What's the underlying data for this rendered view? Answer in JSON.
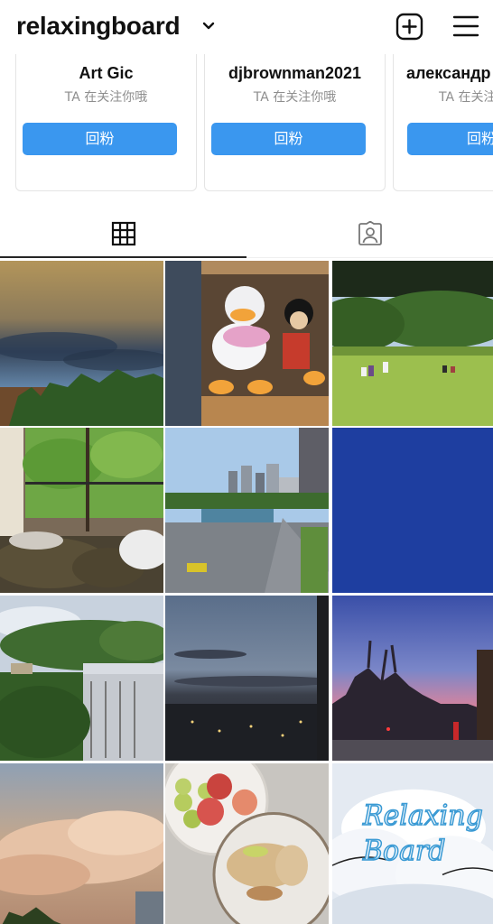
{
  "header": {
    "username": "relaxingboard",
    "icons": {
      "chevron": "chevron-down-icon",
      "new_post": "plus-square-icon",
      "menu": "menu-icon"
    }
  },
  "suggested": [
    {
      "name": "Art Gic",
      "subtitle": "TA 在关注你哦",
      "button": "回粉"
    },
    {
      "name": "djbrownman2021",
      "subtitle": "TA 在关注你哦",
      "button": "回粉"
    },
    {
      "name": "александр",
      "subtitle": "TA 在关注你哦",
      "button": "回粉"
    }
  ],
  "tabs": [
    {
      "name": "posts-grid",
      "icon": "grid-icon",
      "active": true
    },
    {
      "name": "tagged",
      "icon": "tagged-user-icon",
      "active": false
    }
  ],
  "posts": [
    {
      "subject": "dramatic-cloudy-sky"
    },
    {
      "subject": "disney-plush-shelf"
    },
    {
      "subject": "park-picnic-lawn"
    },
    {
      "subject": "bedroom-window-trees"
    },
    {
      "subject": "city-skyline-moat"
    },
    {
      "subject": "solid-blue"
    },
    {
      "subject": "trees-and-building"
    },
    {
      "subject": "dusk-city-lights"
    },
    {
      "subject": "sunset-street-trees"
    },
    {
      "subject": "pink-clouds-sky"
    },
    {
      "subject": "fruit-bowl-toast"
    },
    {
      "subject": "relaxing-board-clouds",
      "overlay_text": [
        "Relaxing",
        "Board"
      ]
    }
  ],
  "colors": {
    "button_blue": "#3a97ef",
    "text": "#262626",
    "muted": "#8e8e8e"
  }
}
